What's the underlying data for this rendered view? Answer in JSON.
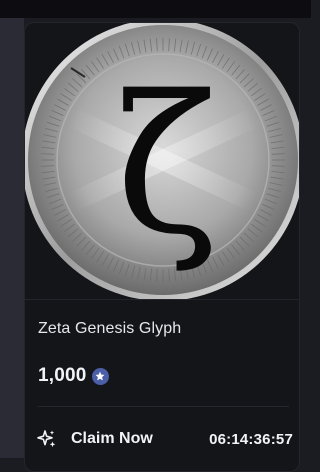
{
  "nft": {
    "title": "Zeta Genesis Glyph",
    "image_icon": "zeta-coin-image",
    "glyph": "ζ"
  },
  "price": {
    "amount": "1,000",
    "currency_icon": "star-icon"
  },
  "claim": {
    "label": "Claim Now",
    "icon": "sparkle-icon",
    "countdown": "06:14:36:57"
  },
  "colors": {
    "background": "#1b1c22",
    "card": "#141519",
    "accent": "#4b5ea8",
    "text": "#f2f3f6"
  }
}
